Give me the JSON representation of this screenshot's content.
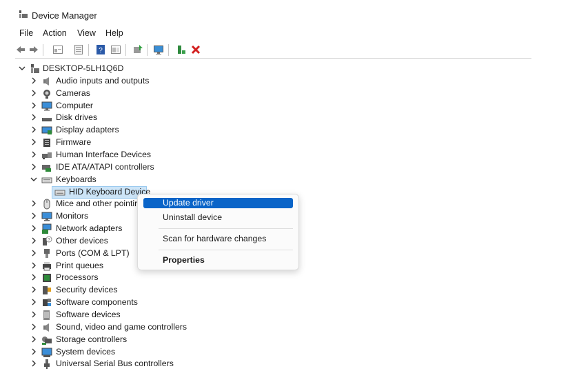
{
  "window": {
    "title": "Device Manager"
  },
  "menu": [
    "File",
    "Action",
    "View",
    "Help"
  ],
  "toolbar": {
    "buttons": [
      "back-icon",
      "forward-icon",
      "properties-view-icon",
      "show-hidden-icon",
      "help-icon",
      "action-view-icon",
      "update-driver-icon",
      "scan-hardware-icon",
      "enable-device-icon",
      "uninstall-icon"
    ]
  },
  "tree": {
    "root": "DESKTOP-5LH1Q6D",
    "categories": [
      {
        "label": "Audio inputs and outputs",
        "icon": "speaker-icon"
      },
      {
        "label": "Cameras",
        "icon": "camera-icon"
      },
      {
        "label": "Computer",
        "icon": "monitor-icon"
      },
      {
        "label": "Disk drives",
        "icon": "disk-drive-icon"
      },
      {
        "label": "Display adapters",
        "icon": "display-adapter-icon"
      },
      {
        "label": "Firmware",
        "icon": "firmware-icon"
      },
      {
        "label": "Human Interface Devices",
        "icon": "hid-icon"
      },
      {
        "label": "IDE ATA/ATAPI controllers",
        "icon": "ide-controller-icon"
      },
      {
        "label": "Keyboards",
        "icon": "keyboard-icon",
        "expanded": true,
        "children": [
          "HID Keyboard Device"
        ]
      },
      {
        "label": "Mice and other pointir",
        "icon": "mouse-icon"
      },
      {
        "label": "Monitors",
        "icon": "monitor-icon"
      },
      {
        "label": "Network adapters",
        "icon": "network-adapter-icon"
      },
      {
        "label": "Other devices",
        "icon": "unknown-device-icon"
      },
      {
        "label": "Ports (COM & LPT)",
        "icon": "port-icon"
      },
      {
        "label": "Print queues",
        "icon": "printer-icon"
      },
      {
        "label": "Processors",
        "icon": "processor-icon"
      },
      {
        "label": "Security devices",
        "icon": "security-device-icon"
      },
      {
        "label": "Software components",
        "icon": "software-component-icon"
      },
      {
        "label": "Software devices",
        "icon": "software-device-icon"
      },
      {
        "label": "Sound, video and game controllers",
        "icon": "sound-controller-icon"
      },
      {
        "label": "Storage controllers",
        "icon": "storage-controller-icon"
      },
      {
        "label": "System devices",
        "icon": "system-device-icon"
      },
      {
        "label": "Universal Serial Bus controllers",
        "icon": "usb-icon"
      }
    ]
  },
  "context_menu": {
    "items": [
      "Update driver",
      "Uninstall device",
      "Scan for hardware changes",
      "Properties"
    ],
    "highlighted": "Update driver",
    "highlight_color": "#0a64c8"
  }
}
